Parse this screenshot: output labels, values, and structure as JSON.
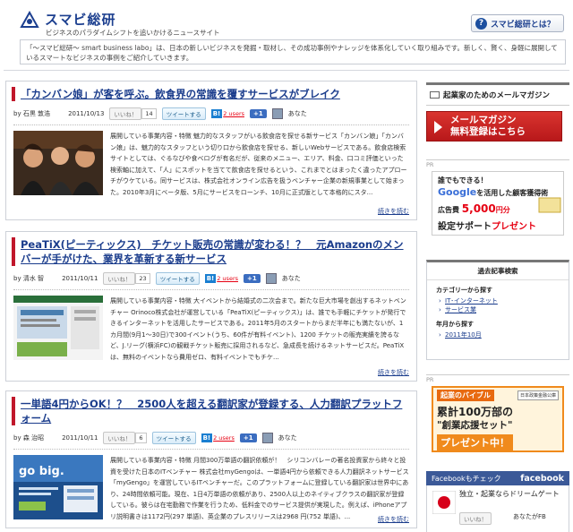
{
  "site": {
    "title": "スマビ総研",
    "subtitle": "ビジネスのパラダイムシフトを追いかけるニュースサイト",
    "about_button": "スマビ総研とは？",
    "intro": "「〜スマビ総研〜 smart business labo」は、日本の新しいビジネスを発掘・取材し、その成功事例やナレッジを体系化していく取り組みです。新しく、賢く、身軽に展開しているスマートなビジネスの事例をご紹介していきます。"
  },
  "common": {
    "like_label": "いいね！",
    "tweet_label": "ツイートする",
    "hatena_label": "B!",
    "users_label": "2 users",
    "plus_label": "+1",
    "you_label": "あなた",
    "by_label": "by",
    "more_label": "続きを読む"
  },
  "articles": [
    {
      "title": "「カンバン娘」が客を呼ぶ。飲食界の常識を覆すサービスがブレイク",
      "author": "石黒 敦浩",
      "date": "2011/10/13",
      "like_count": "14",
      "text": "展開している事業内容・特徴 魅力的なスタッフがいる飲食店を探せる新サービス「カンバン娘」「カンバン娘」は、魅力的なスタッフという切り口から飲食店を探せる、新しいWebサービスである。飲食店検索サイトとしては、ぐるなびや食べログが有名だが、従来のメニュー、エリア、料金、口コミ評価といった検索軸に加えて、「人」にスポットを当てて飲食店を探せるという、これまでとはまったく違ったアプローチがウケている。同サービスは、株式会社オンライン広告を扱うベンチャー企業の新規事業として始まった。2010年3月にベータ版、5月にサービスをローンチ、10月に正式版として本格的にスタ..."
    },
    {
      "title": "PeaTiX(ピーティックス)　チケット販売の常識が変わる！？　元Amazonのメンバーが手がけた、業界を革新する新サービス",
      "author": "清水 智",
      "date": "2011/10/11",
      "like_count": "23",
      "text": "展開している事業内容・特徴 大イベントから結婚式の二次会まで。新たな巨大市場を創出するネットベンチャー Orinoco株式会社が運営している「PeaTiX(ピーティックス)」は、誰でも手軽にチケットが発行できるインターネットを活用したサービスである。2011年5月のスタートからまだ半年にも満たないが、1カ月間(9月1〜30日)で300イベント(うち、60件が有料イベント)、1200 チケットの販売実績を誇るなど、J.リーグ(横浜FC)の観戦チケット販売に採用されるなど、急成長を続けるネットサービスだ。PeaTiXは、無料のイベントなら費用ゼロ、有料イベントでもチケ..."
    },
    {
      "title": "一単語4円からOK！？　2500人を超える翻訳家が登録する、人力翻訳プラットフォーム",
      "author": "森 治昭",
      "date": "2011/10/11",
      "like_count": "6",
      "text": "展開している事業内容・特徴 月間300万単語の翻訳依頼が！　シリコンバレーの著名投資家から終々と投資を受けた日本のITベンチャー 株式会社myGengoは、一単語4円から依頼できる人力翻訳ネットサービス「myGengo」を運営しているITベンチャーだ。このプラットフォームに登録している翻訳家は世界中にあり、24時間依頼可能。現在、1日4万単語の依頼があり、2500人以上のネイティブクラスの翻訳家が登録している。彼らは在宅勤務で作業を行うため、低料金でのサービス提供が実現した。例えば、iPhoneアプリ説明書きは1172円(297 単語)、英企業のプレスリリースは2968 円(752 単語)、..."
    }
  ],
  "sidebar": {
    "mail_title": "起業家のためのメールマガジン",
    "mail_button_line1": "メールマガジン",
    "mail_button_line2": "無料登録はこちら",
    "pr_label": "PR",
    "ad1": {
      "line1": "誰でもできる！",
      "google": "Google",
      "line2": "を活用した顧客獲得術",
      "line3": "広告費",
      "amount": "5,000",
      "unit": "円分",
      "line4": "設定サポート",
      "present": "プレゼント"
    },
    "archive": {
      "title": "過去記事検索",
      "category_head": "カテゴリ一から探す",
      "categories": [
        "IT･インターネット",
        "サービス業"
      ],
      "year_head": "年月から探す",
      "months": [
        "2011年10月"
      ]
    },
    "ad2": {
      "line1": "起業のバイブル",
      "badge": "日本政策金融公庫",
      "line2": "累計100万部の",
      "line3": "\"創業応援セット\"",
      "line4": "プレゼント中！"
    },
    "facebook": {
      "check_label": "Facebookもチェック",
      "fb_label": "facebook",
      "page_name": "独立・起業ならドリームゲート",
      "like_label": "いいね！",
      "friends_text": "あなたがFB"
    }
  }
}
